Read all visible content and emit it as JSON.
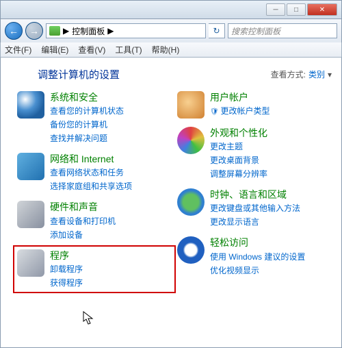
{
  "breadcrumb": "控制面板",
  "breadcrumb_sep": "▶",
  "search_placeholder": "搜索控制面板",
  "menu": {
    "file": "文件(F)",
    "edit": "编辑(E)",
    "view": "查看(V)",
    "tools": "工具(T)",
    "help": "帮助(H)"
  },
  "header": {
    "title": "调整计算机的设置",
    "view_by_label": "查看方式:",
    "view_by_value": "类别"
  },
  "left_col": [
    {
      "icon": "ico-shield",
      "name": "system-security",
      "title": "系统和安全",
      "links": [
        "查看您的计算机状态",
        "备份您的计算机",
        "查找并解决问题"
      ]
    },
    {
      "icon": "ico-network",
      "name": "network-internet",
      "title": "网络和 Internet",
      "links": [
        "查看网络状态和任务",
        "选择家庭组和共享选项"
      ]
    },
    {
      "icon": "ico-hardware",
      "name": "hardware-sound",
      "title": "硬件和声音",
      "links": [
        "查看设备和打印机",
        "添加设备"
      ]
    },
    {
      "icon": "ico-programs",
      "name": "programs",
      "title": "程序",
      "links": [
        "卸载程序",
        "获得程序"
      ],
      "highlighted": true
    }
  ],
  "right_col": [
    {
      "icon": "ico-users",
      "name": "user-accounts",
      "title": "用户帐户",
      "links": [
        "更改帐户类型"
      ],
      "shield": true
    },
    {
      "icon": "ico-appearance",
      "name": "appearance-personalization",
      "title": "外观和个性化",
      "links": [
        "更改主题",
        "更改桌面背景",
        "调整屏幕分辨率"
      ]
    },
    {
      "icon": "ico-clock",
      "name": "clock-language-region",
      "title": "时钟、语言和区域",
      "links": [
        "更改键盘或其他输入方法",
        "更改显示语言"
      ]
    },
    {
      "icon": "ico-ease",
      "name": "ease-of-access",
      "title": "轻松访问",
      "links": [
        "使用 Windows 建议的设置",
        "优化视频显示"
      ]
    }
  ]
}
